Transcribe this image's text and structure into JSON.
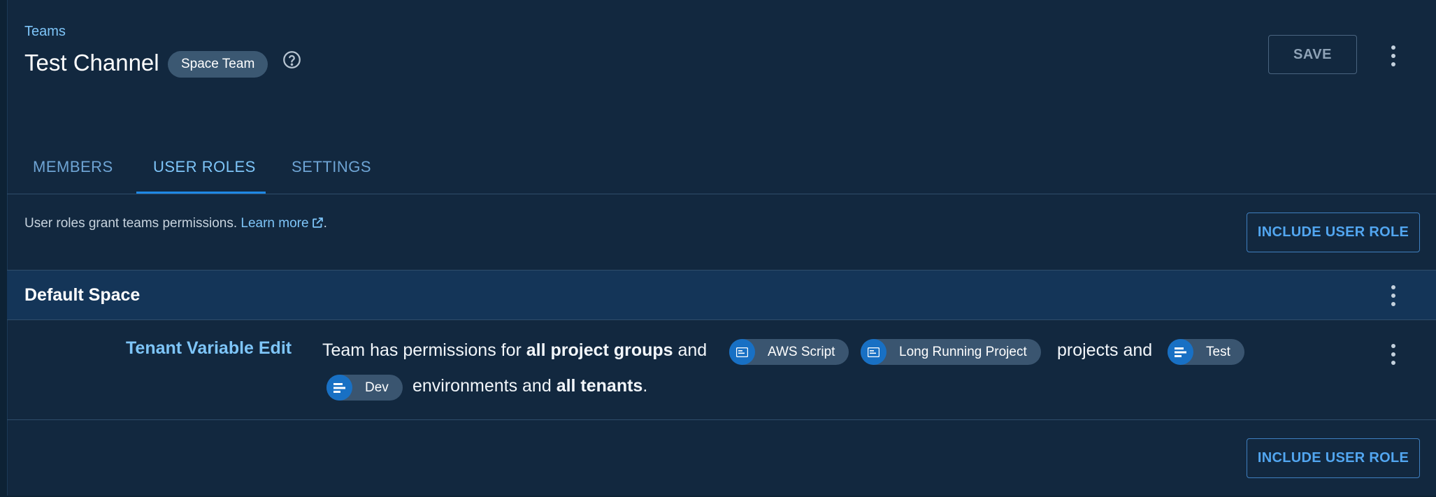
{
  "header": {
    "breadcrumb": "Teams",
    "title": "Test Channel",
    "badge": "Space Team",
    "save_label": "SAVE"
  },
  "tabs": [
    {
      "label": "MEMBERS",
      "active": false
    },
    {
      "label": "USER ROLES",
      "active": true
    },
    {
      "label": "SETTINGS",
      "active": false
    }
  ],
  "description": {
    "text": "User roles grant teams permissions.",
    "link_text": "Learn more",
    "trailing": "."
  },
  "include_button_label": "INCLUDE USER ROLE",
  "space": {
    "name": "Default Space"
  },
  "role": {
    "name": "Tenant Variable Edit",
    "text_1": "Team has permissions for",
    "bold_1": "all project groups",
    "text_2": "and",
    "projects": [
      "AWS Script",
      "Long Running Project"
    ],
    "text_3": "projects and",
    "environments": [
      "Test",
      "Dev"
    ],
    "text_4": "environments and",
    "bold_2": "all tenants",
    "text_5": "."
  },
  "colors": {
    "accent": "#1E88E5",
    "link": "#7EC5F8",
    "background": "#12283F",
    "space_band": "#143558"
  },
  "icons": [
    "help-circle-icon",
    "more-vertical-icon",
    "external-link-icon",
    "project-icon",
    "environment-icon"
  ]
}
